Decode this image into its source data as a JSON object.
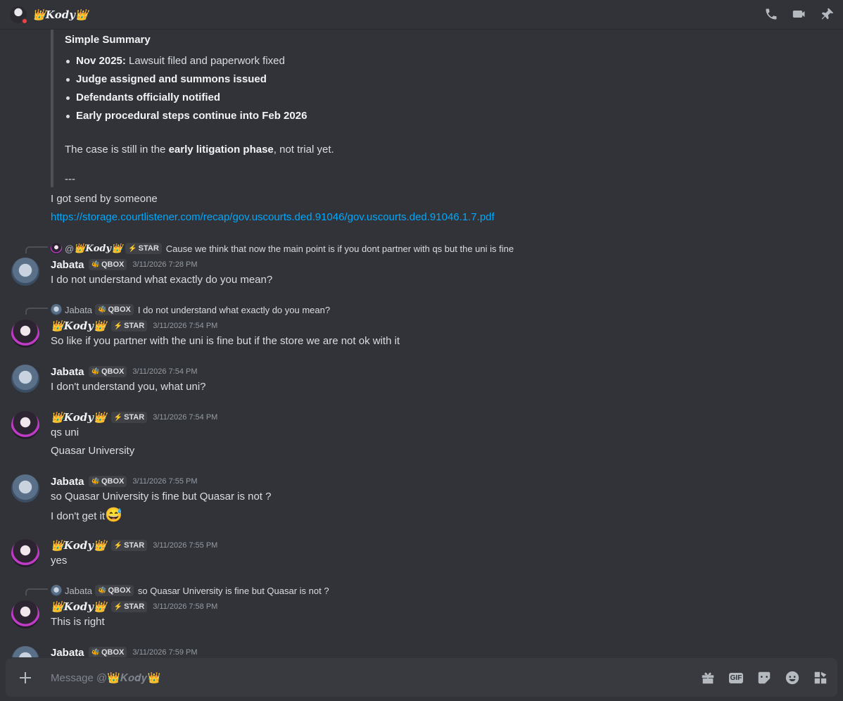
{
  "header": {
    "name": "👑𝑲𝒐𝒅𝒚👑",
    "actions": [
      "voice-call-icon",
      "video-call-icon",
      "pin-icon"
    ]
  },
  "quote": {
    "title": "Simple Summary",
    "items": [
      {
        "bold": "Nov 2025:",
        "rest": " Lawsuit filed and paperwork fixed"
      },
      {
        "bold": "Judge assigned and summons issued",
        "rest": ""
      },
      {
        "bold": "Defendants officially notified",
        "rest": ""
      },
      {
        "bold": "Early procedural steps continue into Feb 2026",
        "rest": ""
      }
    ],
    "case_pre": "The case is still in the ",
    "case_bold": "early litigation phase",
    "case_post": ", not trial yet.",
    "dash": "---"
  },
  "pre_messages": {
    "sent": "I got send by someone",
    "link": "https://storage.courtlistener.com/recap/gov.uscourts.ded.91046/gov.uscourts.ded.91046.1.7.pdf"
  },
  "messages": [
    {
      "reply": {
        "at": "@",
        "name": "👑𝑲𝒐𝒅𝒚👑",
        "tag": "STAR",
        "text": "Cause we think that now the main point is if you dont partner with qs but  the uni is fine"
      },
      "author": "Jabata",
      "tag": "QBOX",
      "time": "3/11/2026 7:28 PM",
      "lines": [
        "I do not understand what exactly do you mean?"
      ]
    },
    {
      "reply": {
        "name": "Jabata",
        "tag": "QBOX",
        "text": "I do not understand what exactly do you mean?"
      },
      "author": "👑𝑲𝒐𝒅𝒚👑",
      "tag": "STAR",
      "time": "3/11/2026 7:54 PM",
      "lines": [
        "So like if you partner with the uni is fine but if the store we are not ok with it"
      ]
    },
    {
      "author": "Jabata",
      "tag": "QBOX",
      "time": "3/11/2026 7:54 PM",
      "lines": [
        "I don't understand you, what uni?"
      ]
    },
    {
      "author": "👑𝑲𝒐𝒅𝒚👑",
      "tag": "STAR",
      "time": "3/11/2026 7:54 PM",
      "lines": [
        "qs uni",
        "Quasar University"
      ]
    },
    {
      "author": "Jabata",
      "tag": "QBOX",
      "time": "3/11/2026 7:55 PM",
      "lines": [
        "so Quasar University is fine but Quasar is not ?",
        "I don't get it",
        "😅"
      ]
    },
    {
      "author": "👑𝑲𝒐𝒅𝒚👑",
      "tag": "STAR",
      "time": "3/11/2026 7:55 PM",
      "lines": [
        "yes"
      ]
    },
    {
      "reply": {
        "name": "Jabata",
        "tag": "QBOX",
        "text": "so Quasar University is fine but Quasar is not ?"
      },
      "author": "👑𝑲𝒐𝒅𝒚👑",
      "tag": "STAR",
      "time": "3/11/2026 7:58 PM",
      "lines": [
        "This is right"
      ]
    },
    {
      "author": "Jabata",
      "tag": "QBOX",
      "time": "3/11/2026 7:59 PM",
      "lines": []
    }
  ],
  "composer": {
    "placeholder": "Message @👑𝑲𝒐𝒅𝒚👑",
    "gif_label": "GIF",
    "actions": [
      "gift-icon",
      "gif-icon",
      "sticker-icon",
      "emoji-icon",
      "apps-icon"
    ]
  }
}
